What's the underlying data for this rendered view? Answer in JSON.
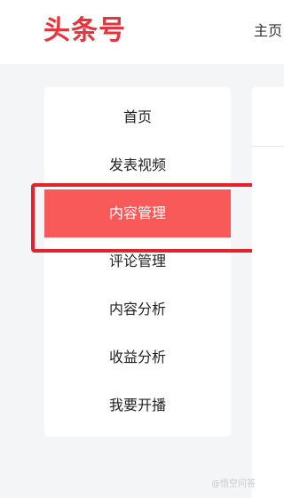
{
  "header": {
    "logo": "头条号",
    "nav_home": "主页"
  },
  "sidebar": {
    "items": [
      {
        "label": "首页",
        "active": false
      },
      {
        "label": "发表视频",
        "active": false
      },
      {
        "label": "内容管理",
        "active": true
      },
      {
        "label": "评论管理",
        "active": false
      },
      {
        "label": "内容分析",
        "active": false
      },
      {
        "label": "收益分析",
        "active": false
      },
      {
        "label": "我要开播",
        "active": false
      }
    ]
  },
  "watermark": "@悟空问答",
  "colors": {
    "brand": "#e8343d",
    "active_bg": "#f85959",
    "highlight_border": "#e4222a"
  }
}
